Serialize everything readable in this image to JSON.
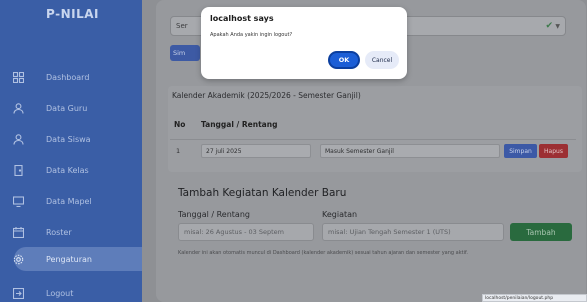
{
  "sidebar": {
    "brand": "P-NILAI",
    "items": [
      {
        "label": "Dashboard",
        "icon": "dashboard-icon"
      },
      {
        "label": "Data Guru",
        "icon": "user-icon"
      },
      {
        "label": "Data Siswa",
        "icon": "user-icon"
      },
      {
        "label": "Data Kelas",
        "icon": "door-icon"
      },
      {
        "label": "Data Mapel",
        "icon": "monitor-icon"
      },
      {
        "label": "Roster",
        "icon": "calendar-icon"
      },
      {
        "label": "Pengaturan",
        "icon": "gear-icon",
        "active": true
      },
      {
        "label": "Logout",
        "icon": "logout-icon"
      }
    ]
  },
  "main": {
    "select_value": "Ser",
    "simpan_short": "Sim",
    "calendar_title": "Kalender Akademik (2025/2026 - Semester Ganjil)",
    "table": {
      "headers": [
        "No",
        "Tanggal / Rentang"
      ],
      "rows": [
        {
          "no": "1",
          "date": "27 juli 2025",
          "activity": "Masuk Semester Ganjil",
          "save": "Simpan",
          "delete": "Hapus"
        }
      ]
    },
    "add_title": "Tambah Kegiatan Kalender Baru",
    "date_label": "Tanggal / Rentang",
    "activity_label": "Kegiatan",
    "date_placeholder": "misal: 26 Agustus - 03 Septem",
    "activity_placeholder": "misal: Ujian Tengah Semester 1 (UTS)",
    "add_button": "Tambah",
    "note": "Kalender ini akan otomatis muncul di Dashboard (kalender akademik) sesuai tahun ajaran dan semester yang aktif."
  },
  "dialog": {
    "title": "localhost says",
    "message": "Apakah Anda yakin ingin logout?",
    "ok": "OK",
    "cancel": "Cancel"
  },
  "status_bar": {
    "url": "localhost/penilaian/logout.php"
  },
  "colors": {
    "sidebar": "#3a5ea6",
    "primary": "#1b5ed6",
    "success": "#296a3e",
    "danger": "#9c2f33"
  }
}
